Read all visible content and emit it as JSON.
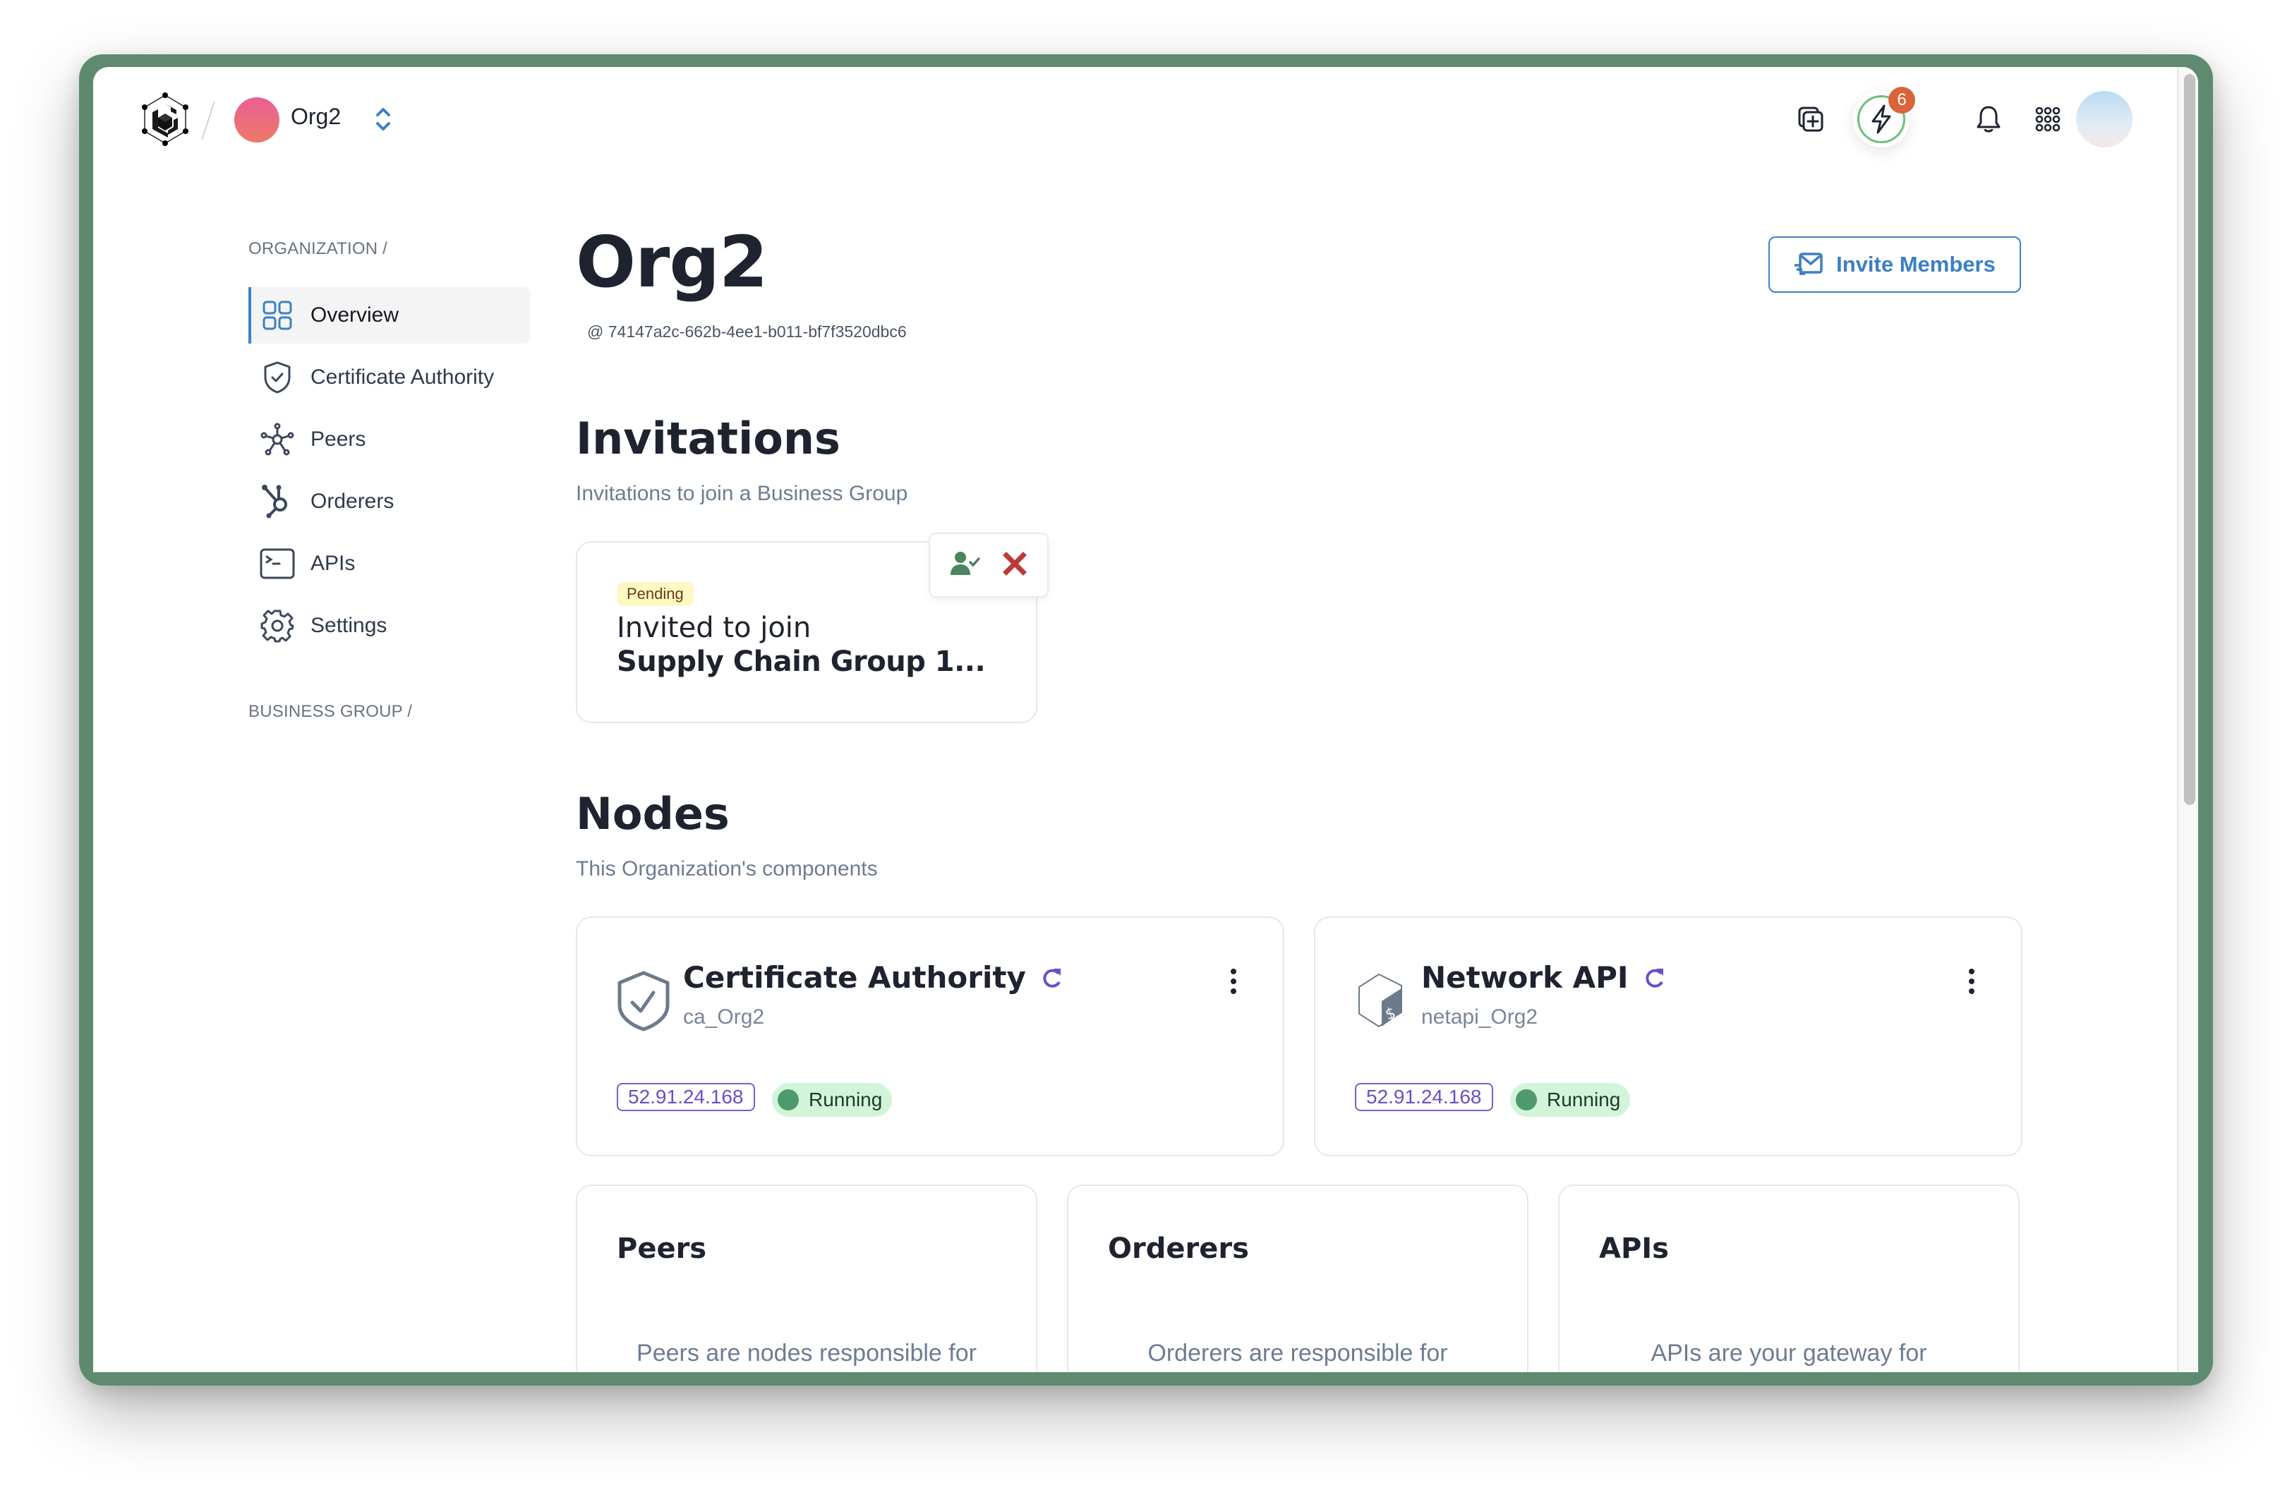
{
  "header": {
    "org_name": "Org2",
    "activity_badge_count": "6",
    "colors": {
      "accent": "#3b82c4",
      "frame": "#5e8b70",
      "badge": "#d9643a",
      "ring": "#6cbf7b"
    }
  },
  "sidebar": {
    "section_organization": "ORGANIZATION /",
    "section_business_group": "BUSINESS GROUP /",
    "items": [
      {
        "label": "Overview",
        "icon": "grid-icon",
        "active": true
      },
      {
        "label": "Certificate Authority",
        "icon": "shield-check-icon",
        "active": false
      },
      {
        "label": "Peers",
        "icon": "network-hub-icon",
        "active": false
      },
      {
        "label": "Orderers",
        "icon": "orderer-icon",
        "active": false
      },
      {
        "label": "APIs",
        "icon": "terminal-icon",
        "active": false
      },
      {
        "label": "Settings",
        "icon": "gear-icon",
        "active": false
      }
    ]
  },
  "main": {
    "title": "Org2",
    "org_id": "@ 74147a2c-662b-4ee1-b011-bf7f3520dbc6",
    "invite_button": "Invite Members",
    "invitations": {
      "title": "Invitations",
      "subtitle": "Invitations to join a Business Group",
      "items": [
        {
          "status": "Pending",
          "line1": "Invited to join",
          "line2": "Supply Chain Group 1..."
        }
      ]
    },
    "nodes": {
      "title": "Nodes",
      "subtitle": "This Organization's components",
      "items": [
        {
          "title": "Certificate Authority",
          "name": "ca_Org2",
          "ip": "52.91.24.168",
          "status": "Running"
        },
        {
          "title": "Network API",
          "name": "netapi_Org2",
          "ip": "52.91.24.168",
          "status": "Running"
        }
      ]
    },
    "summaries": [
      {
        "title": "Peers",
        "description": "Peers are nodes responsible for"
      },
      {
        "title": "Orderers",
        "description": "Orderers are responsible for"
      },
      {
        "title": "APIs",
        "description": "APIs are your gateway for"
      }
    ]
  }
}
